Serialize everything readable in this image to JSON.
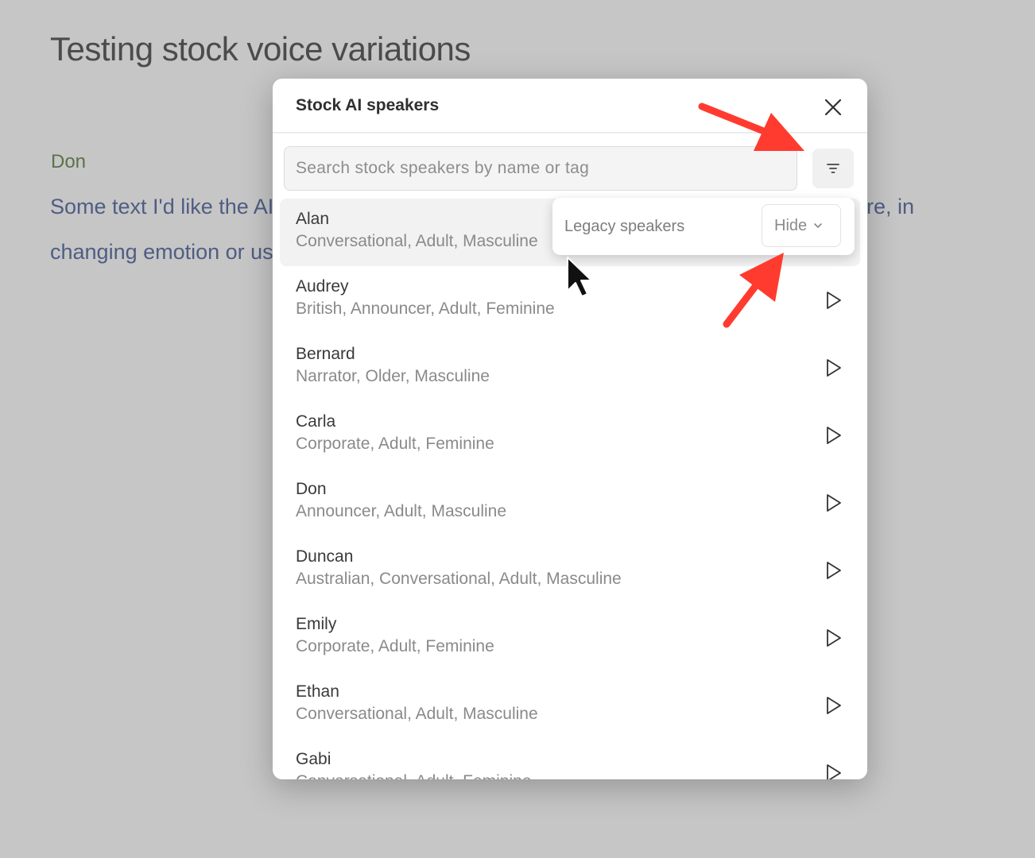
{
  "document": {
    "title": "Testing stock voice variations",
    "speaker": "Don",
    "text_line1": "Some text I'd like the AI",
    "text_line1_end": "re, in",
    "text_line2": "changing emotion or us"
  },
  "modal": {
    "title": "Stock AI speakers",
    "search_placeholder": "Search stock speakers by name or tag",
    "speakers": [
      {
        "name": "Alan",
        "tags": "Conversational, Adult, Masculine"
      },
      {
        "name": "Audrey",
        "tags": "British, Announcer, Adult, Feminine"
      },
      {
        "name": "Bernard",
        "tags": "Narrator, Older, Masculine"
      },
      {
        "name": "Carla",
        "tags": "Corporate, Adult, Feminine"
      },
      {
        "name": "Don",
        "tags": "Announcer, Adult, Masculine"
      },
      {
        "name": "Duncan",
        "tags": "Australian, Conversational, Adult, Masculine"
      },
      {
        "name": "Emily",
        "tags": "Corporate, Adult, Feminine"
      },
      {
        "name": "Ethan",
        "tags": "Conversational, Adult, Masculine"
      },
      {
        "name": "Gabi",
        "tags": "Conversational, Adult, Feminine"
      }
    ]
  },
  "filter_popover": {
    "label": "Legacy speakers",
    "selected": "Hide"
  },
  "colors": {
    "annotation_arrow": "#ff3b30",
    "speaker_label": "#5b7249",
    "body_text": "#4f5d83"
  }
}
